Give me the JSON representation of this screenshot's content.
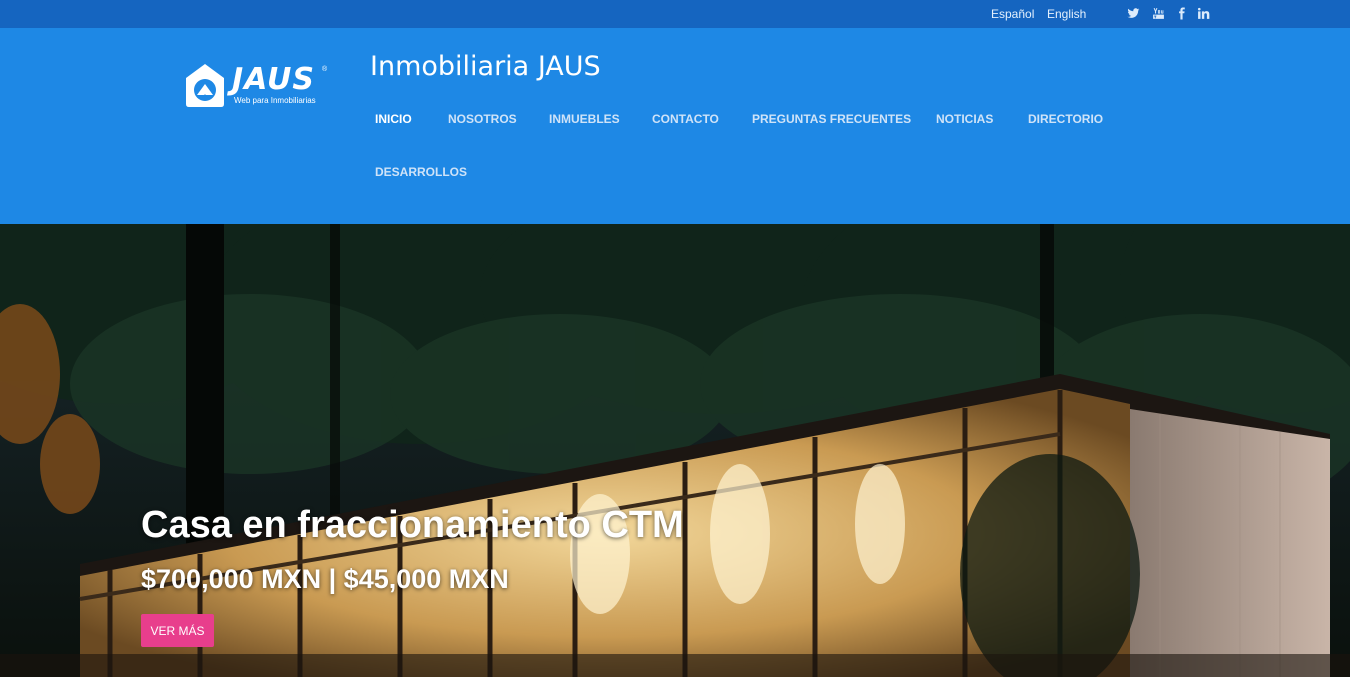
{
  "topbar": {
    "languages": [
      "Español",
      "English"
    ],
    "social": [
      "twitter-icon",
      "youtube-icon",
      "facebook-icon",
      "linkedin-icon"
    ]
  },
  "logo": {
    "word": "JAUS",
    "tagline": "Web para Inmobiliarias",
    "mark": "®"
  },
  "header": {
    "title": "Inmobiliaria JAUS"
  },
  "nav": {
    "items": [
      "INICIO",
      "NOSOTROS",
      "INMUEBLES",
      "CONTACTO",
      "PREGUNTAS FRECUENTES",
      "NOTICIAS",
      "DIRECTORIO",
      "DESARROLLOS"
    ],
    "active": "INICIO"
  },
  "hero": {
    "title": "Casa en fraccionamiento CTM",
    "price": "$700,000 MXN | $45,000 MXN",
    "button": "VER MÁS"
  },
  "colors": {
    "topbar": "#1565c0",
    "header": "#1e88e5",
    "button": "#e83e8c"
  }
}
